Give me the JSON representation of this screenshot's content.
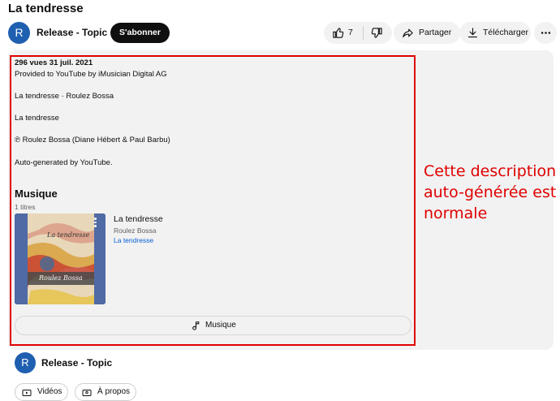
{
  "video": {
    "title": "La tendresse",
    "channel": {
      "avatar_letter": "R",
      "name": "Release - Topic",
      "subscribe_label": "S'abonner"
    },
    "actions": {
      "like_count": "7",
      "share_label": "Partager",
      "download_label": "Télécharger"
    }
  },
  "description": {
    "meta": "296 vues  31 juil. 2021",
    "lines": [
      "Provided to YouTube by iMusician Digital AG",
      "La tendresse · Roulez Bossa",
      "La tendresse",
      "℗ Roulez Bossa (Diane Hébert & Paul Barbu)",
      "Auto-generated by YouTube."
    ],
    "music": {
      "heading": "Musique",
      "count": "1 titres",
      "cover_text": "La tendresse",
      "cover_signature": "Roulez Bossa",
      "track_title": "La tendresse",
      "track_artist": "Roulez Bossa",
      "track_album": "La tendresse",
      "button_label": "Musique"
    }
  },
  "annotation": {
    "text": "Cette description auto-générée est normale",
    "color": "#e00000"
  },
  "bottom": {
    "channel_avatar_letter": "R",
    "channel_name": "Release - Topic",
    "chips": {
      "videos": "Vidéos",
      "about": "À propos"
    }
  },
  "colors": {
    "accent": "#065fd4",
    "avatar": "#1f5fb0",
    "highlight": "#e00000"
  }
}
